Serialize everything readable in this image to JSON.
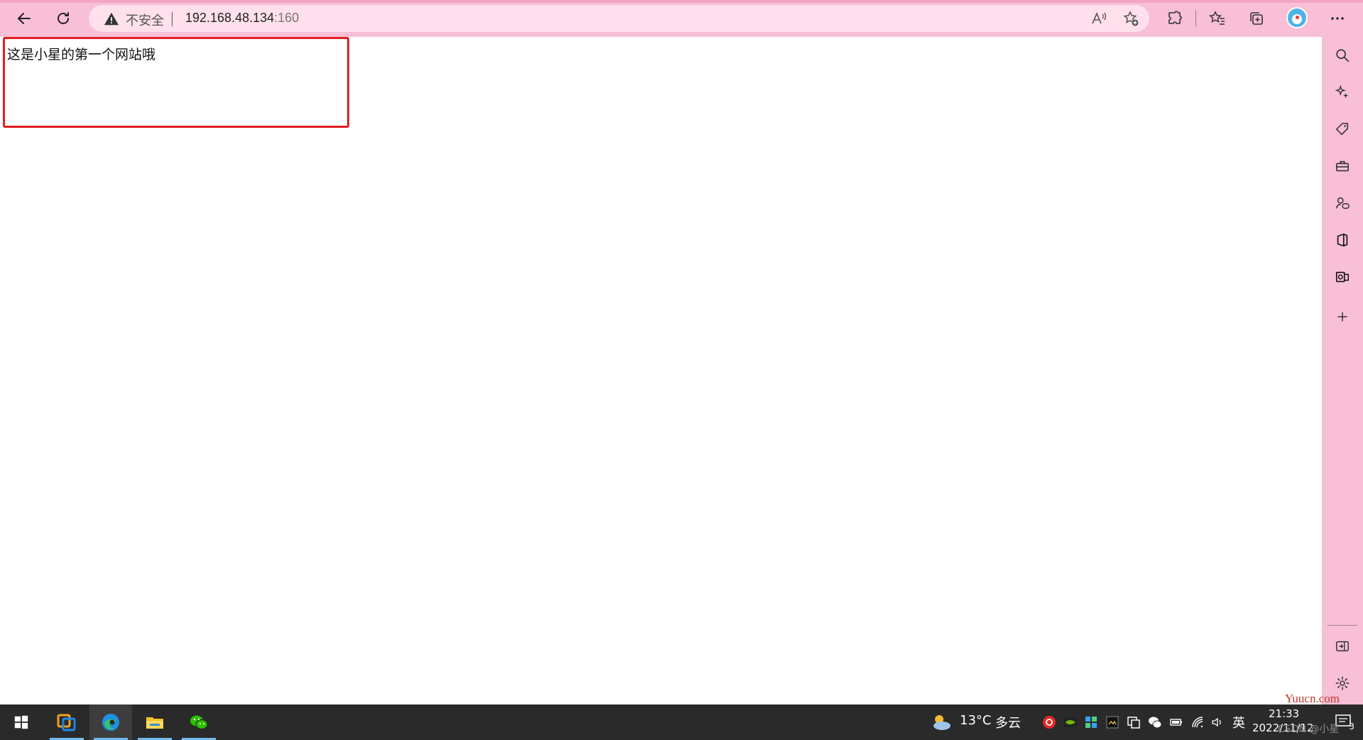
{
  "browser": {
    "address_bar": {
      "security_label": "不安全",
      "url_host": "192.168.48.134",
      "url_port": ":160"
    }
  },
  "page": {
    "body_text": "这是小星的第一个网站哦"
  },
  "taskbar": {
    "weather_temp": "13°C",
    "weather_desc": "多云",
    "ime": "英",
    "time": "21:33",
    "date": "2022/11/12",
    "notification_count": "3"
  },
  "watermark": {
    "site": "Yuucn.com",
    "author": "CSDN @小星"
  },
  "colors": {
    "theme_pink": "#f8bfd6",
    "address_bg": "#ffe0ec",
    "highlight_red": "#e21e26",
    "taskbar_bg": "#2a2a2a"
  }
}
